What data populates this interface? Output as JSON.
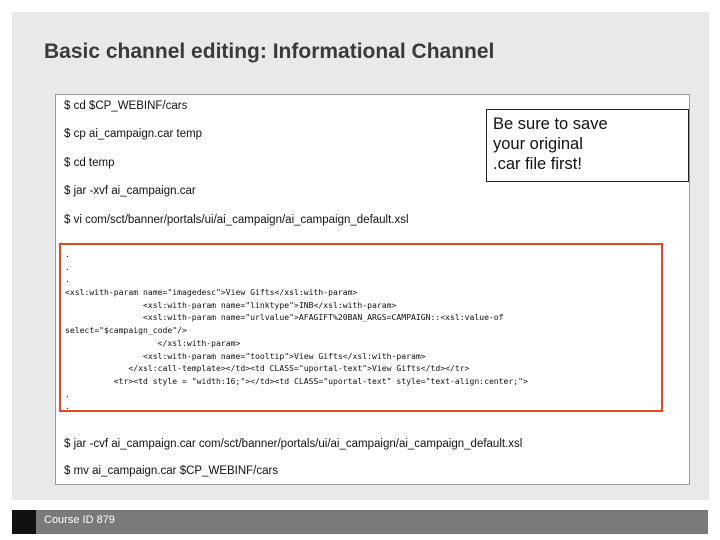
{
  "slide": {
    "title": "Basic channel editing: Informational Channel",
    "commands": [
      "$ cd $CP_WEBINF/cars",
      "$ cp ai_campaign.car temp",
      "$ cd temp",
      "$ jar -xvf ai_campaign.car",
      "$ vi com/sct/banner/portals/ui/ai_campaign/ai_campaign_default.xsl"
    ],
    "note": [
      "Be sure to save",
      "your original",
      ".car file first!"
    ],
    "code_lines": [
      ".",
      ".",
      ".",
      "<xsl:with-param name=\"imagedesc\">View Gifts</xsl:with-param>",
      "                <xsl:with-param name=\"linktype\">INB</xsl:with-param>",
      "                <xsl:with-param name=\"urlvalue\">AFAGIFT%20BAN_ARGS=CAMPAIGN::<xsl:value-of",
      "select=\"$campaign_code\"/>",
      "                   </xsl:with-param>",
      "                <xsl:with-param name=\"tooltip\">View Gifts</xsl:with-param>",
      "             </xsl:call-template></td><td CLASS=\"uportal-text\">View Gifts</td></tr>",
      "          <tr><td style = \"width:16;\"></td><td CLASS=\"uportal-text\" style=\"text-align:center;\">",
      ".",
      ".",
      "."
    ],
    "commands_after": [
      "$ jar -cvf ai_campaign.car com/sct/banner/portals/ui/ai_campaign/ai_campaign_default.xsl",
      "$ mv ai_campaign.car $CP_WEBINF/cars"
    ],
    "footer": "Course ID 879"
  }
}
